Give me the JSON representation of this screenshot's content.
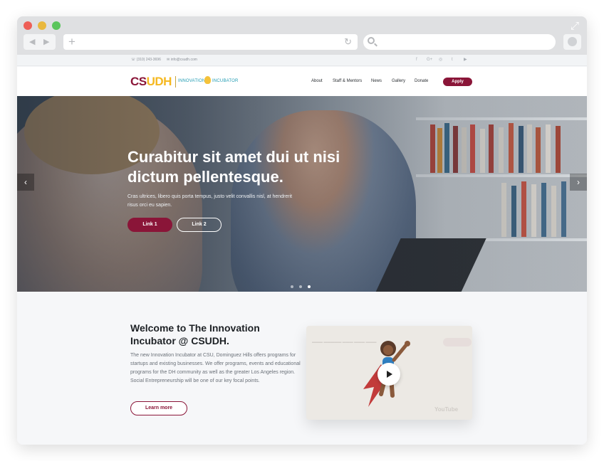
{
  "browser": {
    "back_icon": "◀",
    "forward_icon": "▶",
    "new_tab_icon": "+",
    "reload_icon": "↻",
    "expand_icon": "⤢"
  },
  "topbar": {
    "phone": "(310) 243-3696",
    "email": "info@csudh.com",
    "social": [
      "f",
      "G+",
      "◎",
      "t",
      "▶"
    ]
  },
  "logo": {
    "csudh_part1": "CS",
    "csudh_part2": "UDH",
    "innovation": "INNOVATION",
    "incubator": "INCUBATOR"
  },
  "nav": {
    "items": [
      "About",
      "Staff & Mentors",
      "News",
      "Gallery",
      "Donate"
    ],
    "apply_label": "Apply"
  },
  "hero": {
    "title": "Curabitur sit amet dui ut nisi dictum pellentesque.",
    "subtitle": "Cras ultrices, libero quis porta tempus, justo velit convallis nisl, at hendrerit risus orci eu sapien.",
    "link1": "Link 1",
    "link2": "Link 2",
    "prev_icon": "‹",
    "next_icon": "›",
    "slides": 3,
    "active_slide": 3
  },
  "welcome": {
    "title": "Welcome to The Innovation Incubator @ CSUDH.",
    "body": "The new Innovation Incubator at CSU, Dominguez Hills offers programs for startups and existing businesses. We offer programs, events and educational programs for the DH community as well as the greater Los Angeles region. Social Entrepreneurship will be one of our key focal points.",
    "learn_more": "Learn more"
  },
  "video": {
    "youtube_label": "YouTube"
  },
  "colors": {
    "brand_maroon": "#8a1538",
    "brand_gold": "#f5b820",
    "accent_teal": "#1f9bb2"
  }
}
